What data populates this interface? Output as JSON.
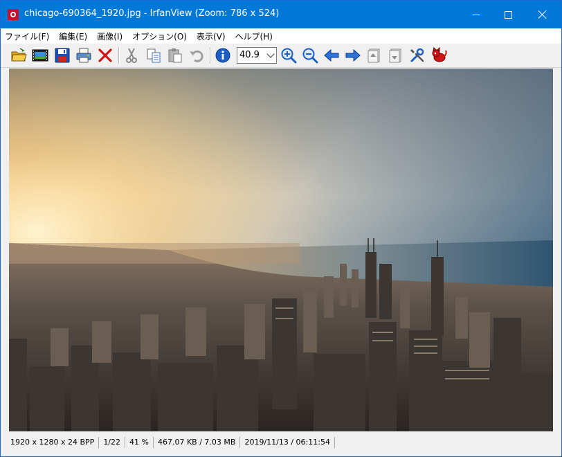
{
  "window": {
    "title": "chicago-690364_1920.jpg - IrfanView (Zoom: 786 x 524)"
  },
  "menu": [
    {
      "label": "ファイル(F)"
    },
    {
      "label": "編集(E)"
    },
    {
      "label": "画像(I)"
    },
    {
      "label": "オプション(O)"
    },
    {
      "label": "表示(V)"
    },
    {
      "label": "ヘルプ(H)"
    }
  ],
  "toolbar": {
    "zoom_value": "40.9",
    "icons": [
      "open-folder-icon",
      "slideshow-icon",
      "save-icon",
      "print-icon",
      "delete-icon",
      "cut-icon",
      "copy-icon",
      "paste-icon",
      "undo-icon",
      "info-icon",
      "zoom-in-icon",
      "zoom-out-icon",
      "previous-arrow-icon",
      "next-arrow-icon",
      "first-page-icon",
      "last-page-icon",
      "settings-tools-icon",
      "irfanview-cat-icon"
    ]
  },
  "colors": {
    "titlebar": "#0078d7",
    "icon_blue": "#1c5fc4",
    "delete_red": "#d21414"
  },
  "status": {
    "dimensions": "1920 x 1280 x 24 BPP",
    "index": "1/22",
    "zoom": "41 %",
    "size": "467.07 KB / 7.03 MB",
    "datetime": "2019/11/13 / 06:11:54"
  }
}
